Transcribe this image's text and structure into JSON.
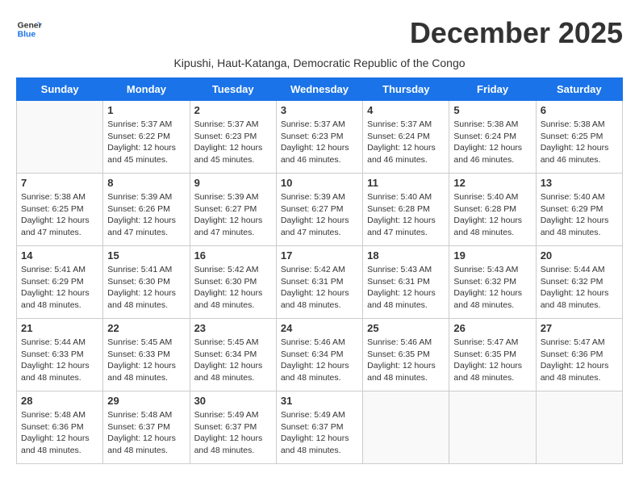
{
  "header": {
    "logo_general": "General",
    "logo_blue": "Blue",
    "month_title": "December 2025",
    "subtitle": "Kipushi, Haut-Katanga, Democratic Republic of the Congo"
  },
  "days_of_week": [
    "Sunday",
    "Monday",
    "Tuesday",
    "Wednesday",
    "Thursday",
    "Friday",
    "Saturday"
  ],
  "weeks": [
    [
      {
        "day": "",
        "sunrise": "",
        "sunset": "",
        "daylight": ""
      },
      {
        "day": "1",
        "sunrise": "Sunrise: 5:37 AM",
        "sunset": "Sunset: 6:22 PM",
        "daylight": "Daylight: 12 hours and 45 minutes."
      },
      {
        "day": "2",
        "sunrise": "Sunrise: 5:37 AM",
        "sunset": "Sunset: 6:23 PM",
        "daylight": "Daylight: 12 hours and 45 minutes."
      },
      {
        "day": "3",
        "sunrise": "Sunrise: 5:37 AM",
        "sunset": "Sunset: 6:23 PM",
        "daylight": "Daylight: 12 hours and 46 minutes."
      },
      {
        "day": "4",
        "sunrise": "Sunrise: 5:37 AM",
        "sunset": "Sunset: 6:24 PM",
        "daylight": "Daylight: 12 hours and 46 minutes."
      },
      {
        "day": "5",
        "sunrise": "Sunrise: 5:38 AM",
        "sunset": "Sunset: 6:24 PM",
        "daylight": "Daylight: 12 hours and 46 minutes."
      },
      {
        "day": "6",
        "sunrise": "Sunrise: 5:38 AM",
        "sunset": "Sunset: 6:25 PM",
        "daylight": "Daylight: 12 hours and 46 minutes."
      }
    ],
    [
      {
        "day": "7",
        "sunrise": "Sunrise: 5:38 AM",
        "sunset": "Sunset: 6:25 PM",
        "daylight": "Daylight: 12 hours and 47 minutes."
      },
      {
        "day": "8",
        "sunrise": "Sunrise: 5:39 AM",
        "sunset": "Sunset: 6:26 PM",
        "daylight": "Daylight: 12 hours and 47 minutes."
      },
      {
        "day": "9",
        "sunrise": "Sunrise: 5:39 AM",
        "sunset": "Sunset: 6:27 PM",
        "daylight": "Daylight: 12 hours and 47 minutes."
      },
      {
        "day": "10",
        "sunrise": "Sunrise: 5:39 AM",
        "sunset": "Sunset: 6:27 PM",
        "daylight": "Daylight: 12 hours and 47 minutes."
      },
      {
        "day": "11",
        "sunrise": "Sunrise: 5:40 AM",
        "sunset": "Sunset: 6:28 PM",
        "daylight": "Daylight: 12 hours and 47 minutes."
      },
      {
        "day": "12",
        "sunrise": "Sunrise: 5:40 AM",
        "sunset": "Sunset: 6:28 PM",
        "daylight": "Daylight: 12 hours and 48 minutes."
      },
      {
        "day": "13",
        "sunrise": "Sunrise: 5:40 AM",
        "sunset": "Sunset: 6:29 PM",
        "daylight": "Daylight: 12 hours and 48 minutes."
      }
    ],
    [
      {
        "day": "14",
        "sunrise": "Sunrise: 5:41 AM",
        "sunset": "Sunset: 6:29 PM",
        "daylight": "Daylight: 12 hours and 48 minutes."
      },
      {
        "day": "15",
        "sunrise": "Sunrise: 5:41 AM",
        "sunset": "Sunset: 6:30 PM",
        "daylight": "Daylight: 12 hours and 48 minutes."
      },
      {
        "day": "16",
        "sunrise": "Sunrise: 5:42 AM",
        "sunset": "Sunset: 6:30 PM",
        "daylight": "Daylight: 12 hours and 48 minutes."
      },
      {
        "day": "17",
        "sunrise": "Sunrise: 5:42 AM",
        "sunset": "Sunset: 6:31 PM",
        "daylight": "Daylight: 12 hours and 48 minutes."
      },
      {
        "day": "18",
        "sunrise": "Sunrise: 5:43 AM",
        "sunset": "Sunset: 6:31 PM",
        "daylight": "Daylight: 12 hours and 48 minutes."
      },
      {
        "day": "19",
        "sunrise": "Sunrise: 5:43 AM",
        "sunset": "Sunset: 6:32 PM",
        "daylight": "Daylight: 12 hours and 48 minutes."
      },
      {
        "day": "20",
        "sunrise": "Sunrise: 5:44 AM",
        "sunset": "Sunset: 6:32 PM",
        "daylight": "Daylight: 12 hours and 48 minutes."
      }
    ],
    [
      {
        "day": "21",
        "sunrise": "Sunrise: 5:44 AM",
        "sunset": "Sunset: 6:33 PM",
        "daylight": "Daylight: 12 hours and 48 minutes."
      },
      {
        "day": "22",
        "sunrise": "Sunrise: 5:45 AM",
        "sunset": "Sunset: 6:33 PM",
        "daylight": "Daylight: 12 hours and 48 minutes."
      },
      {
        "day": "23",
        "sunrise": "Sunrise: 5:45 AM",
        "sunset": "Sunset: 6:34 PM",
        "daylight": "Daylight: 12 hours and 48 minutes."
      },
      {
        "day": "24",
        "sunrise": "Sunrise: 5:46 AM",
        "sunset": "Sunset: 6:34 PM",
        "daylight": "Daylight: 12 hours and 48 minutes."
      },
      {
        "day": "25",
        "sunrise": "Sunrise: 5:46 AM",
        "sunset": "Sunset: 6:35 PM",
        "daylight": "Daylight: 12 hours and 48 minutes."
      },
      {
        "day": "26",
        "sunrise": "Sunrise: 5:47 AM",
        "sunset": "Sunset: 6:35 PM",
        "daylight": "Daylight: 12 hours and 48 minutes."
      },
      {
        "day": "27",
        "sunrise": "Sunrise: 5:47 AM",
        "sunset": "Sunset: 6:36 PM",
        "daylight": "Daylight: 12 hours and 48 minutes."
      }
    ],
    [
      {
        "day": "28",
        "sunrise": "Sunrise: 5:48 AM",
        "sunset": "Sunset: 6:36 PM",
        "daylight": "Daylight: 12 hours and 48 minutes."
      },
      {
        "day": "29",
        "sunrise": "Sunrise: 5:48 AM",
        "sunset": "Sunset: 6:37 PM",
        "daylight": "Daylight: 12 hours and 48 minutes."
      },
      {
        "day": "30",
        "sunrise": "Sunrise: 5:49 AM",
        "sunset": "Sunset: 6:37 PM",
        "daylight": "Daylight: 12 hours and 48 minutes."
      },
      {
        "day": "31",
        "sunrise": "Sunrise: 5:49 AM",
        "sunset": "Sunset: 6:37 PM",
        "daylight": "Daylight: 12 hours and 48 minutes."
      },
      {
        "day": "",
        "sunrise": "",
        "sunset": "",
        "daylight": ""
      },
      {
        "day": "",
        "sunrise": "",
        "sunset": "",
        "daylight": ""
      },
      {
        "day": "",
        "sunrise": "",
        "sunset": "",
        "daylight": ""
      }
    ]
  ]
}
